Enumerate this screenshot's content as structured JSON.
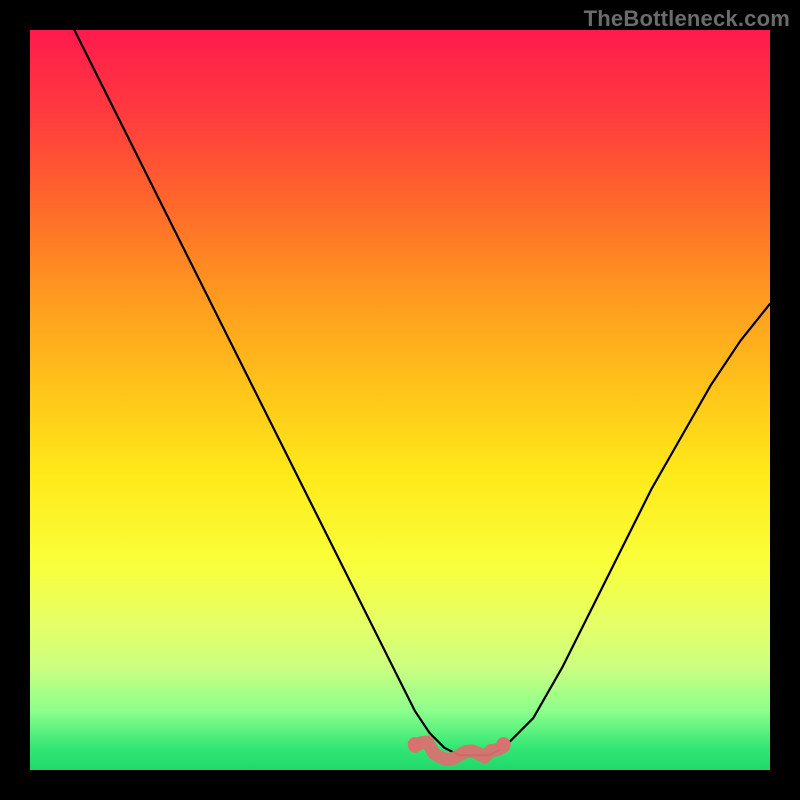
{
  "watermark": {
    "text": "TheBottleneck.com"
  },
  "colors": {
    "curve": "#000000",
    "marker_fill": "#d9716f",
    "marker_stroke": "#c95f5d"
  },
  "chart_data": {
    "type": "line",
    "title": "",
    "xlabel": "",
    "ylabel": "",
    "xlim": [
      0,
      100
    ],
    "ylim": [
      0,
      100
    ],
    "grid": false,
    "legend": false,
    "series": [
      {
        "name": "curve",
        "x": [
          6,
          10,
          14,
          18,
          22,
          26,
          30,
          34,
          38,
          42,
          46,
          50,
          52,
          54,
          56,
          58,
          60,
          62,
          64,
          68,
          72,
          76,
          80,
          84,
          88,
          92,
          96,
          100
        ],
        "y": [
          100,
          92,
          84,
          76,
          68,
          60,
          52,
          44,
          36,
          28,
          20,
          12,
          8,
          5,
          3,
          2,
          2,
          2,
          3,
          7,
          14,
          22,
          30,
          38,
          45,
          52,
          58,
          63
        ]
      }
    ],
    "annotations": [
      {
        "name": "bottom-marker",
        "type": "thick-segment",
        "x_range": [
          52,
          64
        ],
        "y": 2
      }
    ]
  }
}
